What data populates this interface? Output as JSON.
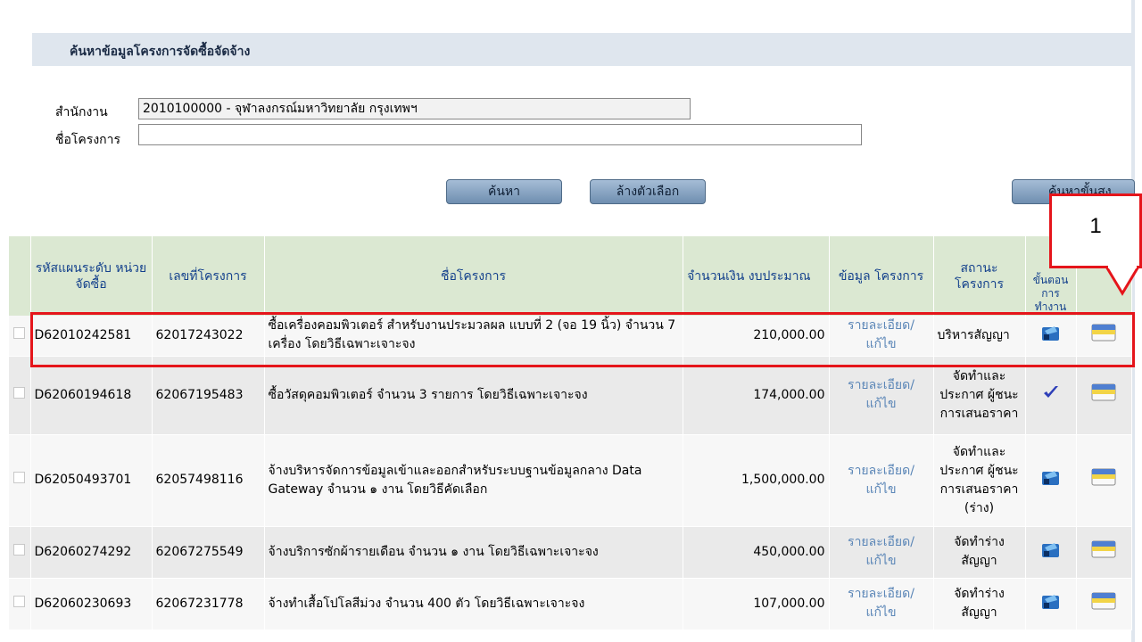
{
  "header": {
    "title": "ค้นหาข้อมูลโครงการจัดซื้อจัดจ้าง"
  },
  "form": {
    "office_label": "สำนักงาน",
    "office_value": "2010100000 - จุฬาลงกรณ์มหาวิทยาลัย กรุงเทพฯ",
    "project_label": "ชื่อโครงการ",
    "project_value": ""
  },
  "buttons": {
    "search": "ค้นหา",
    "clear": "ล้างตัวเลือก",
    "advanced": "ค้นหาขั้นสูง"
  },
  "table": {
    "headers": {
      "plan_code": "รหัสแผนระดับ หน่วยจัดซื้อ",
      "project_no": "เลขที่โครงการ",
      "project_name": "ชื่อโครงการ",
      "budget": "จำนวนเงิน งบประมาณ",
      "info": "ข้อมูล โครงการ",
      "status": "สถานะ โครงการ",
      "steps": "ขั้นตอน การ ทำงาน"
    },
    "rows": [
      {
        "plan_code": "D62010242581",
        "project_no": "62017243022",
        "name": "ซื้อเครื่องคอมพิวเตอร์ สำหรับงานประมวลผล แบบที่ 2 (จอ 19 นิ้ว) จำนวน 7 เครื่อง โดยวิธีเฉพาะเจาะจง",
        "budget": "210,000.00",
        "link": "รายละเอียด/แก้ไข",
        "status": "บริหารสัญญา",
        "icon": "work-icon"
      },
      {
        "plan_code": "D62060194618",
        "project_no": "62067195483",
        "name": "ซื้อวัสดุคอมพิวเตอร์ จำนวน 3 รายการ โดยวิธีเฉพาะเจาะจง",
        "budget": "174,000.00",
        "link": "รายละเอียด/แก้ไข",
        "status": "จัดทำและประกาศ ผู้ชนะการเสนอราคา",
        "icon": "check-icon"
      },
      {
        "plan_code": "D62050493701",
        "project_no": "62057498116",
        "name": "จ้างบริหารจัดการข้อมูลเข้าและออกสำหรับระบบฐานข้อมูลกลาง Data Gateway จำนวน ๑ งาน โดยวิธีคัดเลือก",
        "budget": "1,500,000.00",
        "link": "รายละเอียด/แก้ไข",
        "status": "จัดทำและประกาศ ผู้ชนะการเสนอราคา (ร่าง)",
        "icon": "work-icon"
      },
      {
        "plan_code": "D62060274292",
        "project_no": "62067275549",
        "name": "จ้างบริการซักผ้ารายเดือน จำนวน ๑ งาน โดยวิธีเฉพาะเจาะจง",
        "budget": "450,000.00",
        "link": "รายละเอียด/แก้ไข",
        "status": "จัดทำร่างสัญญา",
        "icon": "work-icon"
      },
      {
        "plan_code": "D62060230693",
        "project_no": "62067231778",
        "name": "จ้างทำเสื้อโปโลสีม่วง จำนวน 400 ตัว โดยวิธีเฉพาะเจาะจง",
        "budget": "107,000.00",
        "link": "รายละเอียด/แก้ไข",
        "status": "จัดทำร่างสัญญา",
        "icon": "work-icon"
      }
    ]
  },
  "callout": {
    "label": "1"
  },
  "colors": {
    "highlight": "#e5151b",
    "header_bg": "#dbe8d2",
    "link": "#5b86b7"
  }
}
